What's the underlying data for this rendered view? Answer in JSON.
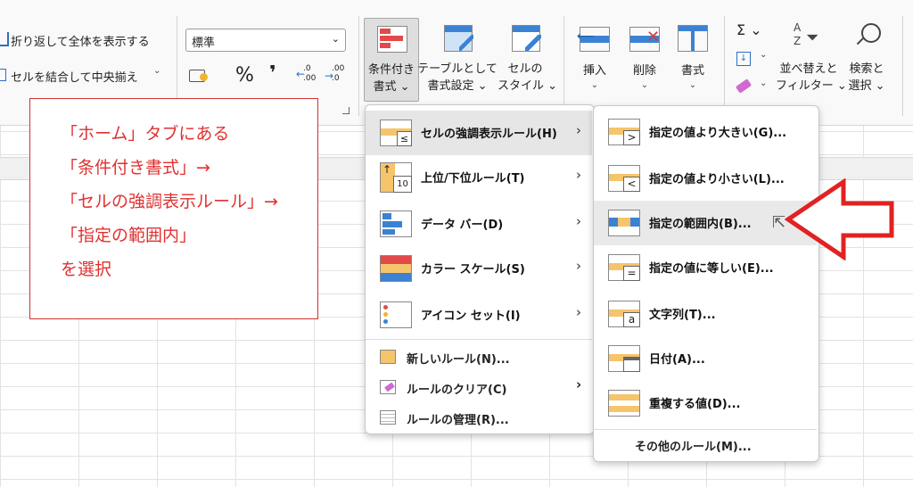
{
  "ribbon": {
    "wrap_text": "折り返して全体を表示する",
    "merge_center": "セルを結合して中央揃え",
    "merge_arrow": "⌄",
    "number_format": "標準",
    "percent": "%",
    "comma": "❜",
    "dec_increase": ".0 .00",
    "dec_decrease": ".00 .0",
    "conditional_format": [
      "条件付き",
      "書式 ⌄"
    ],
    "format_as_table": [
      "テーブルとして",
      "書式設定 ⌄"
    ],
    "cell_styles": [
      "セルの",
      "スタイル ⌄"
    ],
    "insert": "挿入",
    "delete": "削除",
    "format": "書式",
    "sum": "Σ ⌄",
    "fill": "⌄",
    "clear": "⌄",
    "sort_filter": [
      "並べ替えと",
      "フィルター ⌄"
    ],
    "find_select": [
      "検索と",
      "選択 ⌄"
    ],
    "chevron": "⌄"
  },
  "annotation": {
    "lines": [
      "「ホーム」タブにある",
      "「条件付き書式」→",
      "「セルの強調表示ルール」→",
      "「指定の範囲内」",
      "を選択"
    ],
    "color": "#e23030"
  },
  "menu1": {
    "items": [
      {
        "label": "セルの強調表示ルール(H)",
        "icon": "highlight-rules-icon",
        "arrow": "›"
      },
      {
        "label": "上位/下位ルール(T)",
        "icon": "top-bottom-rules-icon",
        "arrow": "›"
      },
      {
        "label": "データ バー(D)",
        "icon": "data-bars-icon",
        "arrow": "›"
      },
      {
        "label": "カラー スケール(S)",
        "icon": "color-scales-icon",
        "arrow": "›"
      },
      {
        "label": "アイコン セット(I)",
        "icon": "icon-sets-icon",
        "arrow": "›"
      }
    ],
    "extra": [
      {
        "label": "新しいルール(N)...",
        "icon": "new-rule-icon"
      },
      {
        "label": "ルールのクリア(C)",
        "icon": "clear-rules-icon",
        "arrow": "›"
      },
      {
        "label": "ルールの管理(R)...",
        "icon": "manage-rules-icon"
      }
    ]
  },
  "menu2": {
    "items": [
      {
        "label": "指定の値より大きい(G)...",
        "icon": "greater-than-icon",
        "glyph": ">"
      },
      {
        "label": "指定の値より小さい(L)...",
        "icon": "less-than-icon",
        "glyph": "<"
      },
      {
        "label": "指定の範囲内(B)...",
        "icon": "between-icon",
        "glyph": ""
      },
      {
        "label": "指定の値に等しい(E)...",
        "icon": "equal-to-icon",
        "glyph": "="
      },
      {
        "label": "文字列(T)...",
        "icon": "text-contains-icon",
        "glyph": "a"
      },
      {
        "label": "日付(A)...",
        "icon": "date-occurring-icon",
        "glyph": ""
      },
      {
        "label": "重複する値(D)...",
        "icon": "duplicate-values-icon",
        "glyph": ""
      }
    ],
    "more": "その他のルール(M)..."
  },
  "colors": {
    "accent_red": "#e23030",
    "highlight_orange": "#f6c46a",
    "highlight_blue": "#3b82d4"
  }
}
